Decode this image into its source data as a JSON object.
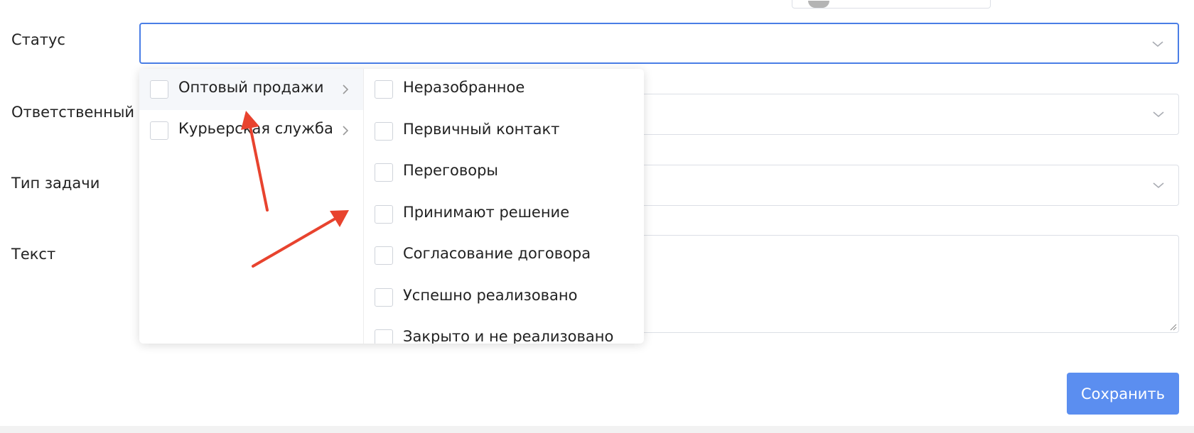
{
  "form": {
    "status": {
      "label": "Статус",
      "value": ""
    },
    "responsible": {
      "label": "Ответственный"
    },
    "task_type": {
      "label": "Тип задачи"
    },
    "text": {
      "label": "Текст"
    }
  },
  "dropdown": {
    "groups": [
      {
        "label": "Оптовый продажи",
        "checked": false,
        "hovered": true
      },
      {
        "label": "Курьерская служба",
        "checked": false,
        "hovered": false
      }
    ],
    "stages": [
      {
        "label": "Неразобранное",
        "checked": false
      },
      {
        "label": "Первичный контакт",
        "checked": false
      },
      {
        "label": "Переговоры",
        "checked": false
      },
      {
        "label": "Принимают решение",
        "checked": false
      },
      {
        "label": "Согласование договора",
        "checked": false
      },
      {
        "label": "Успешно реализовано",
        "checked": false
      },
      {
        "label": "Закрыто и не реализовано",
        "checked": false
      }
    ]
  },
  "buttons": {
    "save_label": "Сохранить"
  },
  "colors": {
    "accent": "#4a7ee6",
    "save_button": "#5b8ef0",
    "annotation_arrow": "#e8432e",
    "border": "#dcdfe6"
  },
  "icons": {
    "field_arrow": "chevron-down-icon",
    "group_arrow": "chevron-right-icon",
    "textarea_corner": "resize-handle-icon"
  }
}
